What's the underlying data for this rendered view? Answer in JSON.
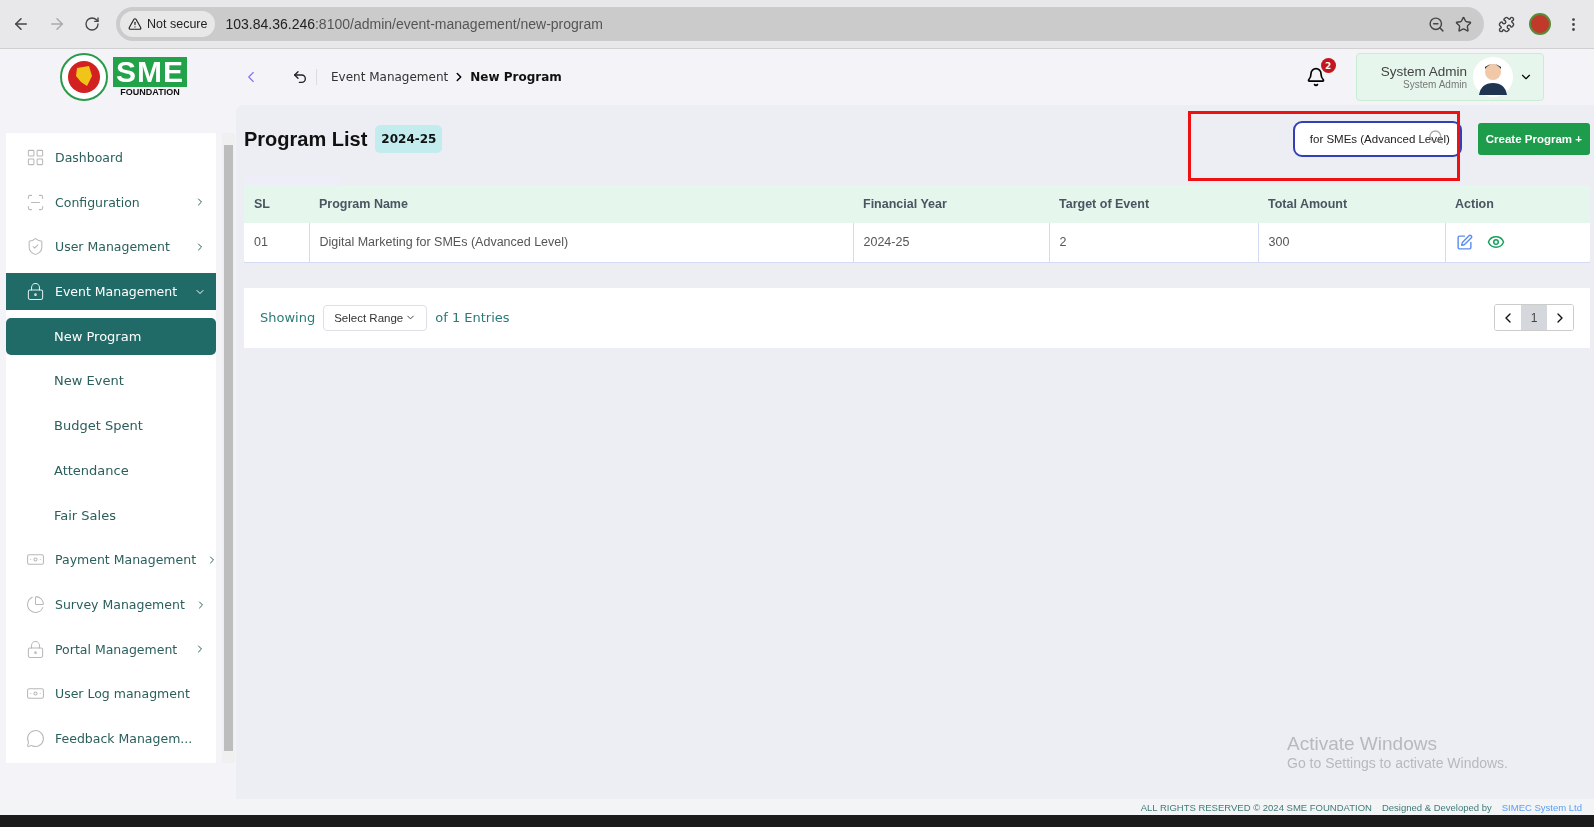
{
  "browser": {
    "security": "Not secure",
    "url_host": "103.84.36.246",
    "url_path": ":8100/admin/event-management/new-program"
  },
  "logo": {
    "mark": "SME",
    "caption": "FOUNDATION"
  },
  "header": {
    "breadcrumb": [
      {
        "label": "Event Management",
        "current": false
      },
      {
        "label": "New Program",
        "current": true
      }
    ],
    "notification_count": "2",
    "user_name": "System Admin",
    "user_role": "System Admin"
  },
  "sidebar": {
    "items": [
      {
        "label": "Dashboard",
        "selected": false
      },
      {
        "label": "Configuration",
        "selected": false,
        "expanded": false
      },
      {
        "label": "User Management",
        "selected": false,
        "expanded": false
      },
      {
        "label": "Event Management",
        "selected": true,
        "expanded": true,
        "children": [
          {
            "label": "New Program",
            "selected": true
          },
          {
            "label": "New Event",
            "selected": false
          },
          {
            "label": "Budget Spent",
            "selected": false
          },
          {
            "label": "Attendance",
            "selected": false
          },
          {
            "label": "Fair Sales",
            "selected": false
          }
        ]
      },
      {
        "label": "Payment Management",
        "selected": false,
        "expanded": false
      },
      {
        "label": "Survey Management",
        "selected": false,
        "expanded": false
      },
      {
        "label": "Portal Management",
        "selected": false,
        "expanded": false
      },
      {
        "label": "User Log managment",
        "selected": false
      },
      {
        "label": "Feedback Managem...",
        "selected": false
      }
    ]
  },
  "page": {
    "title": "Program List",
    "year_badge": "2024-25",
    "search_value": "for SMEs (Advanced Level)",
    "create_button": "Create Program +"
  },
  "table": {
    "columns": [
      "SL",
      "Program Name",
      "Financial Year",
      "Target of Event",
      "Total Amount",
      "Action"
    ],
    "rows": [
      {
        "sl": "01",
        "program_name": "Digital Marketing for SMEs (Advanced Level)",
        "financial_year": "2024-25",
        "target": "2",
        "total_amount": "300"
      }
    ]
  },
  "pagination": {
    "showing": "Showing",
    "range_placeholder": "Select Range",
    "entries": "of 1 Entries",
    "pages": [
      {
        "label": "1",
        "selected": true
      }
    ]
  },
  "windows_notice": {
    "title": "Activate Windows",
    "text": "Go to Settings to activate Windows."
  },
  "footer": {
    "rights": "ALL RIGHTS RESERVED © 2024 SME FOUNDATION",
    "designed": "Designed & Developed by",
    "developer": "SIMEC System Ltd"
  }
}
